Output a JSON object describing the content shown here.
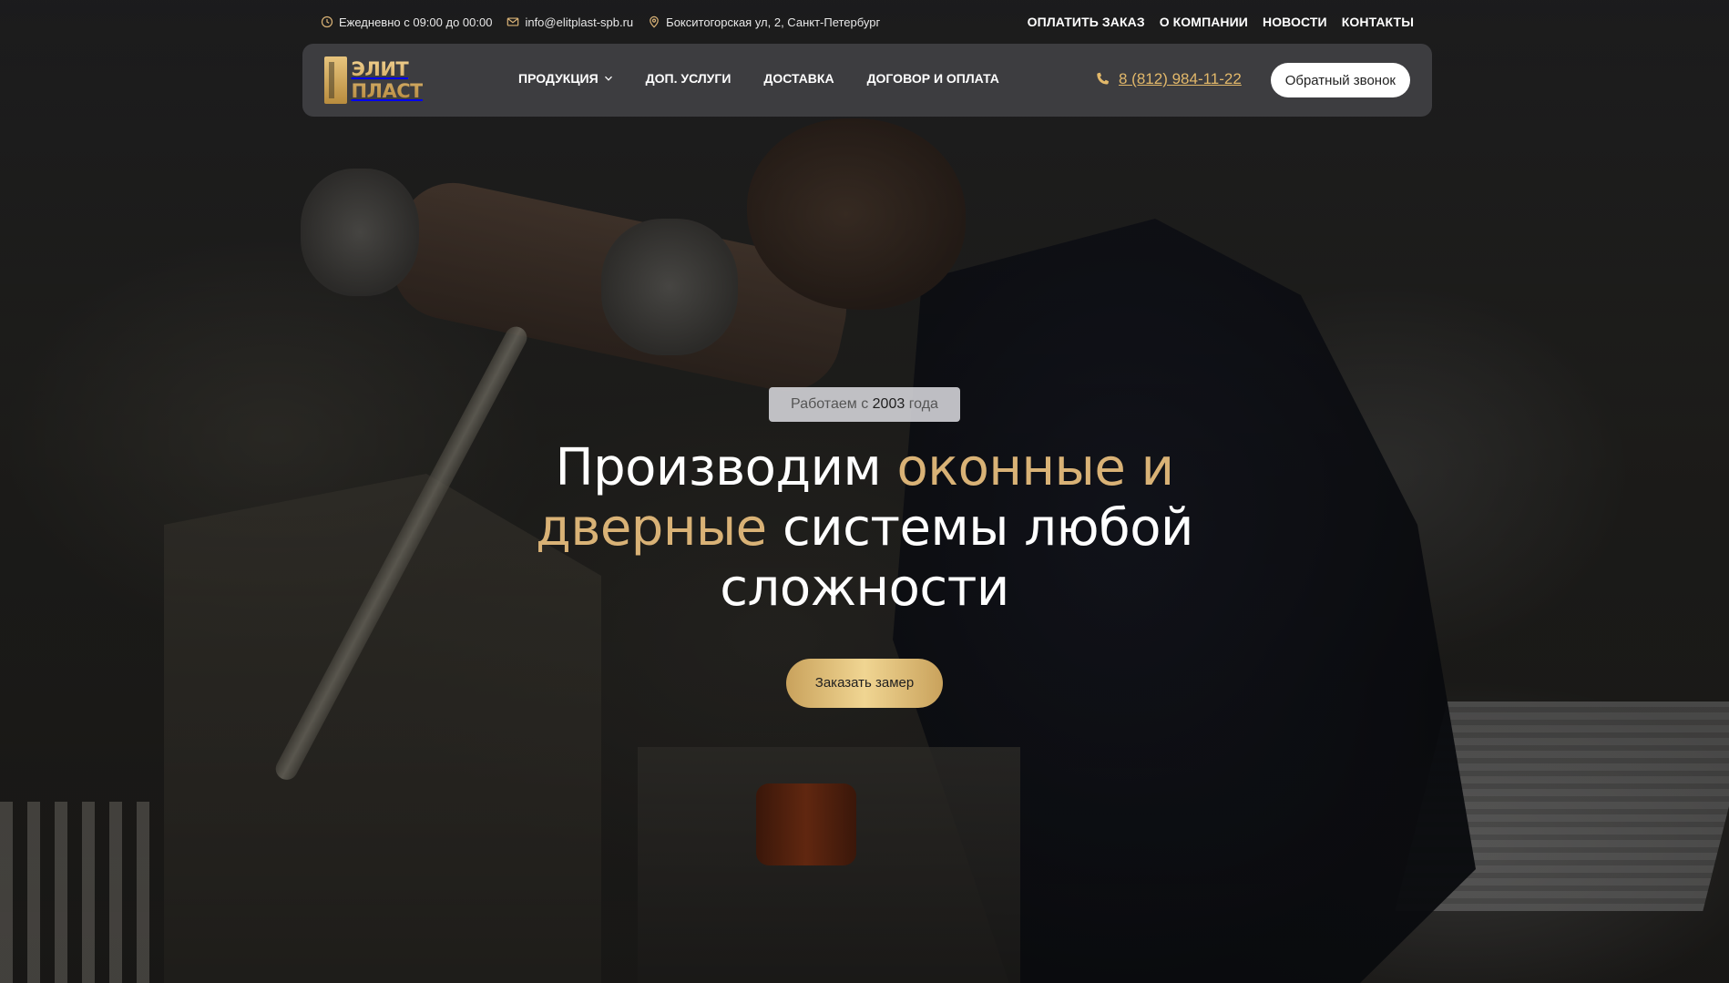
{
  "topbar": {
    "hours": "Ежедневно с 09:00 до 00:00",
    "email": "info@elitplast-spb.ru",
    "address": "Бокситогорская ул, 2, Санкт-Петербург",
    "links": [
      "ОПЛАТИТЬ ЗАКАЗ",
      "О КОМПАНИИ",
      "НОВОСТИ",
      "КОНТАКТЫ"
    ]
  },
  "logo": {
    "line1": "ЭЛИТ",
    "line2": "ПЛАСТ"
  },
  "nav": {
    "items": [
      "ПРОДУКЦИЯ",
      "ДОП. УСЛУГИ",
      "ДОСТАВКА",
      "ДОГОВОР И ОПЛАТА"
    ],
    "phone": "8 (812) 984-11-22",
    "callback_label": "Обратный звонок"
  },
  "hero": {
    "badge_prefix": "Работаем с",
    "badge_year": "2003",
    "badge_suffix": "года",
    "title_part1": "Производим ",
    "title_accent": "оконные и дверные",
    "title_part2": " системы любой сложности",
    "cta_label": "Заказать замер"
  },
  "colors": {
    "accent": "#d9b276",
    "phone": "#e2b86a",
    "cta_gradient": [
      "#c9a25c",
      "#f0d592"
    ]
  },
  "icons": [
    "clock-icon",
    "mail-icon",
    "location-pin-icon",
    "phone-icon",
    "chevron-down-icon"
  ]
}
